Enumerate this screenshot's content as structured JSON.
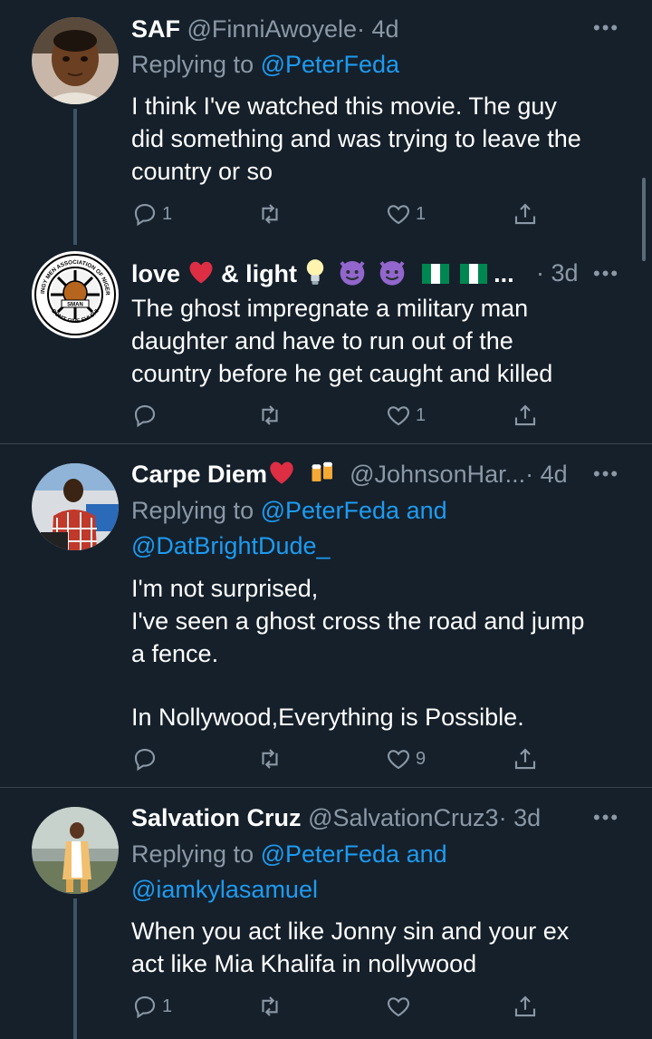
{
  "tweets": [
    {
      "name": "SAF",
      "handle": "@FinniAwoyele",
      "time": "· 4d",
      "replying_prefix": "Replying to ",
      "mentions": [
        "@PeterFeda"
      ],
      "text": [
        "I think I've watched this movie. The guy",
        "did something and was trying to leave the",
        "country or so"
      ],
      "reply_count": "1",
      "retweet_count": "",
      "like_count": "1"
    },
    {
      "name": "love",
      "name_suffix": "& light",
      "name_ellipsis": "...",
      "handle": "",
      "time": "· 3d",
      "avatar_text": {
        "top": "STINGY MEN ASSOCIATION OF NIGERIA",
        "mid": "SMAN",
        "bottom": "DON'T GIVE SHI SHI"
      },
      "text": [
        "The ghost impregnate a military man",
        "daughter and have to run out of the",
        "country before he get caught and killed"
      ],
      "reply_count": "",
      "retweet_count": "",
      "like_count": "1"
    },
    {
      "name": "Carpe Diem",
      "handle": "@JohnsonHar...",
      "time": "· 4d",
      "replying_prefix": "Replying to ",
      "mentions": [
        "@PeterFeda",
        "@DatBrightDude_"
      ],
      "mention_joiner": "and",
      "text": [
        "I'm not surprised,",
        "I've seen a ghost cross the road and jump",
        "a fence.",
        "",
        "In Nollywood,Everything is Possible."
      ],
      "reply_count": "",
      "retweet_count": "",
      "like_count": "9"
    },
    {
      "name": "Salvation Cruz",
      "handle": "@SalvationCruz3",
      "time": "· 3d",
      "replying_prefix": "Replying to ",
      "mentions": [
        "@PeterFeda",
        "@iamkylasamuel"
      ],
      "mention_joiner": "and",
      "text": [
        "When you act like Jonny sin and your ex",
        "act like Mia Khalifa in nollywood"
      ],
      "reply_count": "1",
      "retweet_count": "",
      "like_count": ""
    }
  ],
  "more_label": "•••",
  "icons": {
    "reply": "reply-icon",
    "retweet": "retweet-icon",
    "like": "heart-icon",
    "share": "share-icon"
  },
  "colors": {
    "background": "#15202b",
    "secondary_text": "#8b98a5",
    "mention": "#1d9bf0",
    "divider": "#38444d"
  }
}
